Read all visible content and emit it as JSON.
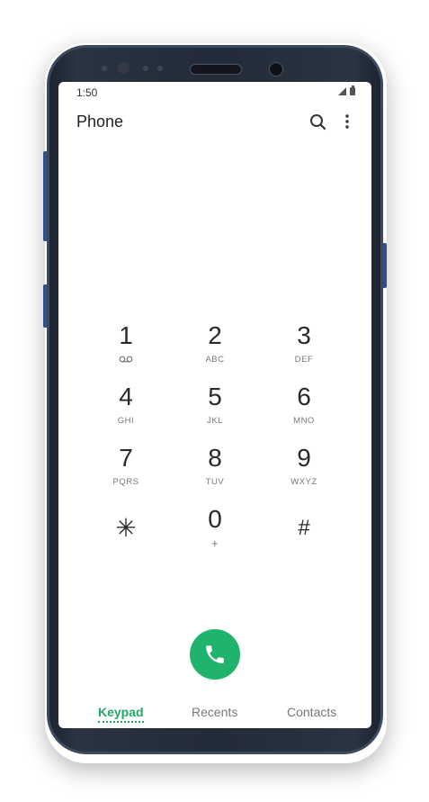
{
  "status_bar": {
    "time": "1:50"
  },
  "app_bar": {
    "title": "Phone",
    "search_icon": "search-icon",
    "more_icon": "more-vertical-icon"
  },
  "keypad": {
    "keys": [
      {
        "digit": "1",
        "letters": "",
        "icon": "voicemail-icon"
      },
      {
        "digit": "2",
        "letters": "ABC"
      },
      {
        "digit": "3",
        "letters": "DEF"
      },
      {
        "digit": "4",
        "letters": "GHI"
      },
      {
        "digit": "5",
        "letters": "JKL"
      },
      {
        "digit": "6",
        "letters": "MNO"
      },
      {
        "digit": "7",
        "letters": "PQRS"
      },
      {
        "digit": "8",
        "letters": "TUV"
      },
      {
        "digit": "9",
        "letters": "WXYZ"
      },
      {
        "digit": "✳",
        "letters": ""
      },
      {
        "digit": "0",
        "letters": "+"
      },
      {
        "digit": "#",
        "letters": ""
      }
    ]
  },
  "call_button": {
    "icon": "phone-icon",
    "color": "#20b36e"
  },
  "tabs": [
    {
      "label": "Keypad",
      "active": true
    },
    {
      "label": "Recents",
      "active": false
    },
    {
      "label": "Contacts",
      "active": false
    }
  ],
  "nav_bar": {
    "recents_icon": "recent-apps-icon",
    "home_icon": "home-icon",
    "back_icon": "back-icon"
  },
  "colors": {
    "accent": "#20a866",
    "call": "#20b36e",
    "device_frame": "#222b37",
    "side_buttons": "#2f4f86"
  }
}
